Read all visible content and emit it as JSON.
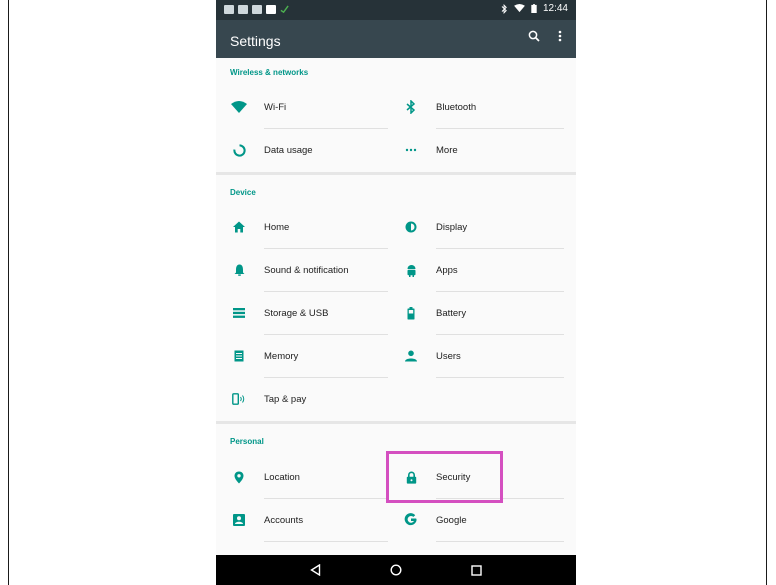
{
  "status_bar": {
    "time": "12:44"
  },
  "app_bar": {
    "title": "Settings"
  },
  "sections": [
    {
      "header": "Wireless & networks",
      "items": [
        {
          "label": "Wi-Fi",
          "icon": "wifi-icon"
        },
        {
          "label": "Bluetooth",
          "icon": "bluetooth-icon"
        },
        {
          "label": "Data usage",
          "icon": "data-usage-icon"
        },
        {
          "label": "More",
          "icon": "more-icon"
        }
      ]
    },
    {
      "header": "Device",
      "items": [
        {
          "label": "Home",
          "icon": "home-icon"
        },
        {
          "label": "Display",
          "icon": "display-icon"
        },
        {
          "label": "Sound & notification",
          "icon": "bell-icon"
        },
        {
          "label": "Apps",
          "icon": "android-icon"
        },
        {
          "label": "Storage & USB",
          "icon": "storage-icon"
        },
        {
          "label": "Battery",
          "icon": "battery-icon"
        },
        {
          "label": "Memory",
          "icon": "memory-icon"
        },
        {
          "label": "Users",
          "icon": "person-icon"
        },
        {
          "label": "Tap & pay",
          "icon": "tap-pay-icon"
        }
      ]
    },
    {
      "header": "Personal",
      "items": [
        {
          "label": "Location",
          "icon": "location-pin-icon"
        },
        {
          "label": "Security",
          "icon": "lock-icon"
        },
        {
          "label": "Accounts",
          "icon": "account-box-icon"
        },
        {
          "label": "Google",
          "icon": "google-icon"
        }
      ]
    }
  ],
  "colors": {
    "accent": "#009688",
    "app_bar": "#37474f",
    "status_bar": "#263238",
    "highlight": "#d44fc0"
  }
}
